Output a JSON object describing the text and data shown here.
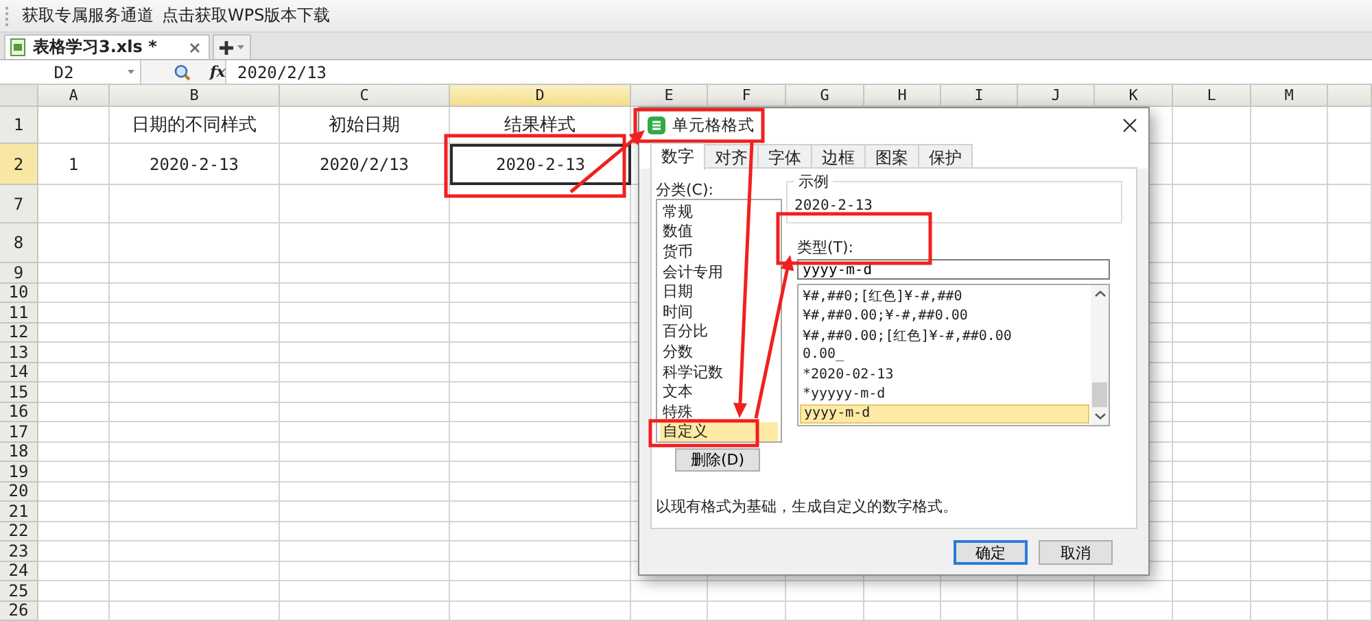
{
  "toolbar": {
    "links": [
      "获取专属服务通道",
      "点击获取WPS版本下载"
    ]
  },
  "file_tabs": [
    {
      "label": "表格学习3.xls *",
      "selected": true
    }
  ],
  "formula_bar": {
    "cell_ref": "D2",
    "function_label": "fx",
    "value": "2020/2/13"
  },
  "sheet": {
    "columns": [
      {
        "label": "A",
        "selected": false
      },
      {
        "label": "B",
        "selected": false
      },
      {
        "label": "C",
        "selected": false
      },
      {
        "label": "D",
        "selected": true
      },
      {
        "label": "E",
        "selected": false
      },
      {
        "label": "F",
        "selected": false
      },
      {
        "label": "G",
        "selected": false
      },
      {
        "label": "H",
        "selected": false
      },
      {
        "label": "I",
        "selected": false
      },
      {
        "label": "J",
        "selected": false
      },
      {
        "label": "K",
        "selected": false
      },
      {
        "label": "L",
        "selected": false
      },
      {
        "label": "M",
        "selected": false
      }
    ],
    "rows": [
      {
        "label": "1",
        "selected": false,
        "cells": {
          "B": {
            "text": "日期的不同样式",
            "selected": false
          },
          "C": {
            "text": "初始日期",
            "selected": false
          },
          "D": {
            "text": "结果样式",
            "selected": false
          }
        }
      },
      {
        "label": "2",
        "selected": true,
        "cells": {
          "A": {
            "text": "1",
            "selected": false
          },
          "B": {
            "text": "2020-2-13",
            "selected": false
          },
          "C": {
            "text": "2020/2/13",
            "selected": false
          },
          "D": {
            "text": "2020-2-13",
            "selected": true
          }
        }
      },
      {
        "label": "7",
        "selected": false
      },
      {
        "label": "8",
        "selected": false
      },
      {
        "label": "9",
        "selected": false
      },
      {
        "label": "10",
        "selected": false
      },
      {
        "label": "11",
        "selected": false
      },
      {
        "label": "12",
        "selected": false
      },
      {
        "label": "13",
        "selected": false
      },
      {
        "label": "14",
        "selected": false
      },
      {
        "label": "15",
        "selected": false
      },
      {
        "label": "16",
        "selected": false
      },
      {
        "label": "17",
        "selected": false
      },
      {
        "label": "18",
        "selected": false
      },
      {
        "label": "19",
        "selected": false
      },
      {
        "label": "20",
        "selected": false
      },
      {
        "label": "21",
        "selected": false
      },
      {
        "label": "22",
        "selected": false
      },
      {
        "label": "23",
        "selected": false
      },
      {
        "label": "24",
        "selected": false
      },
      {
        "label": "25",
        "selected": false
      },
      {
        "label": "26",
        "selected": false
      }
    ]
  },
  "dialog": {
    "title": "单元格格式",
    "tabs": [
      {
        "label": "数字",
        "selected": true
      },
      {
        "label": "对齐",
        "selected": false
      },
      {
        "label": "字体",
        "selected": false
      },
      {
        "label": "边框",
        "selected": false
      },
      {
        "label": "图案",
        "selected": false
      },
      {
        "label": "保护",
        "selected": false
      }
    ],
    "category_label": "分类(C):",
    "categories": [
      {
        "label": "常规",
        "selected": false
      },
      {
        "label": "数值",
        "selected": false
      },
      {
        "label": "货币",
        "selected": false
      },
      {
        "label": "会计专用",
        "selected": false
      },
      {
        "label": "日期",
        "selected": false
      },
      {
        "label": "时间",
        "selected": false
      },
      {
        "label": "百分比",
        "selected": false
      },
      {
        "label": "分数",
        "selected": false
      },
      {
        "label": "科学记数",
        "selected": false
      },
      {
        "label": "文本",
        "selected": false
      },
      {
        "label": "特殊",
        "selected": false
      },
      {
        "label": "自定义",
        "selected": true
      }
    ],
    "delete_button": "删除(D)",
    "sample_label": "示例",
    "sample_value": "2020-2-13",
    "type_label": "类型(T):",
    "type_value": "yyyy-m-d",
    "formats": [
      {
        "label": "¥#,##0;[红色]¥-#,##0",
        "selected": false
      },
      {
        "label": "¥#,##0.00;¥-#,##0.00",
        "selected": false
      },
      {
        "label": "¥#,##0.00;[红色]¥-#,##0.00",
        "selected": false
      },
      {
        "label": "0.00_",
        "selected": false
      },
      {
        "label": "*2020-02-13",
        "selected": false
      },
      {
        "label": "*yyyyy-m-d",
        "selected": false
      },
      {
        "label": "yyyy-m-d",
        "selected": true
      }
    ],
    "description": "以现有格式为基础，生成自定义的数字格式。",
    "buttons": [
      {
        "label": "确定",
        "kind": "primary"
      },
      {
        "label": "取消",
        "kind": "normal"
      }
    ]
  }
}
